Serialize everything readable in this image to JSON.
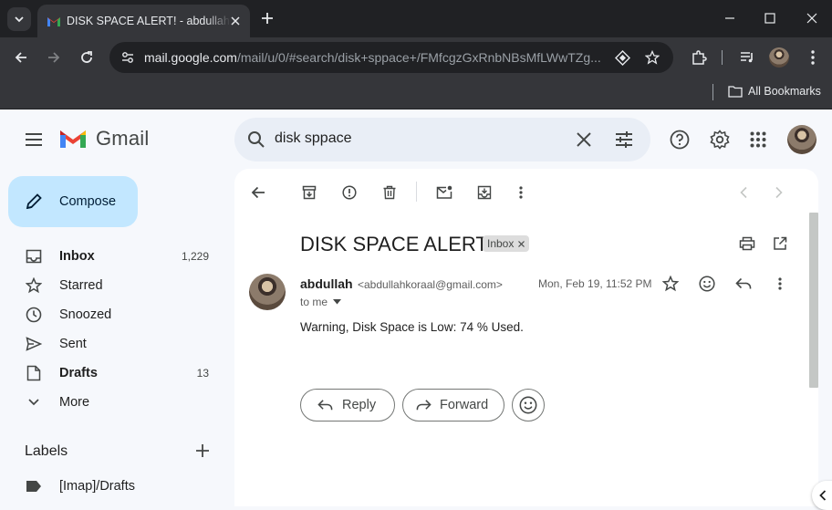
{
  "browser": {
    "tab_title": "DISK SPACE ALERT! - abdullahkoraal@gmail.com - Gmail",
    "url_host": "mail.google.com",
    "url_path": "/mail/u/0/#search/disk+sppace+/FMfcgzGxRnbNBsMfLWwTZg...",
    "bookmarks_label": "All Bookmarks"
  },
  "gmail": {
    "logo_text": "Gmail",
    "search_value": "disk sppace",
    "compose_label": "Compose",
    "nav": [
      {
        "label": "Inbox",
        "count": "1,229"
      },
      {
        "label": "Starred",
        "count": ""
      },
      {
        "label": "Snoozed",
        "count": ""
      },
      {
        "label": "Sent",
        "count": ""
      },
      {
        "label": "Drafts",
        "count": "13"
      },
      {
        "label": "More",
        "count": ""
      }
    ],
    "labels_heading": "Labels",
    "labels": [
      {
        "label": "[Imap]/Drafts"
      }
    ]
  },
  "message": {
    "subject": "DISK SPACE ALERT!",
    "chip": "Inbox",
    "sender_name": "abdullah",
    "sender_email": "<abdullahkoraal@gmail.com>",
    "to": "to me",
    "date": "Mon, Feb 19, 11:52 PM",
    "body": "Warning, Disk Space is Low: 74 % Used.",
    "reply_label": "Reply",
    "forward_label": "Forward"
  },
  "colors": {
    "compose_bg": "#c2e7ff",
    "search_bg": "#e9eef6",
    "page_bg": "#f6f8fc",
    "chrome_dark": "#202124",
    "chrome_toolbar": "#35363a"
  }
}
